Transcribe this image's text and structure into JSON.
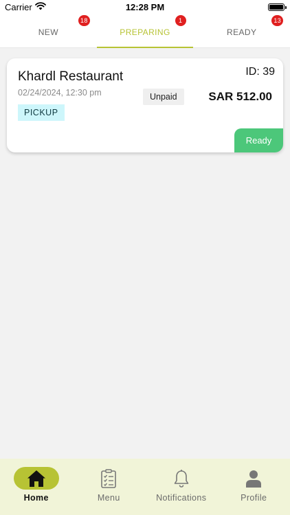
{
  "status_bar": {
    "carrier": "Carrier",
    "time": "12:28 PM"
  },
  "tabs": [
    {
      "label": "NEW",
      "count": "18",
      "active": false
    },
    {
      "label": "PREPARING",
      "count": "1",
      "active": true
    },
    {
      "label": "READY",
      "count": "13",
      "active": false
    }
  ],
  "orders": [
    {
      "restaurant": "Khardl Restaurant",
      "datetime": "02/24/2024, 12:30 pm",
      "type": "PICKUP",
      "id_label": "ID: 39",
      "payment_status": "Unpaid",
      "total": "SAR 512.00",
      "action_label": "Ready"
    }
  ],
  "bottom_nav": [
    {
      "label": "Home",
      "icon": "home-icon",
      "active": true
    },
    {
      "label": "Menu",
      "icon": "menu-checklist-icon",
      "active": false
    },
    {
      "label": "Notifications",
      "icon": "bell-icon",
      "active": false
    },
    {
      "label": "Profile",
      "icon": "user-icon",
      "active": false
    }
  ],
  "colors": {
    "accent": "#b7c334",
    "badge": "#e02020",
    "ready_button": "#4cc77a",
    "pickup_badge": "#cdf6fb",
    "nav_background": "#f1f4d8"
  }
}
